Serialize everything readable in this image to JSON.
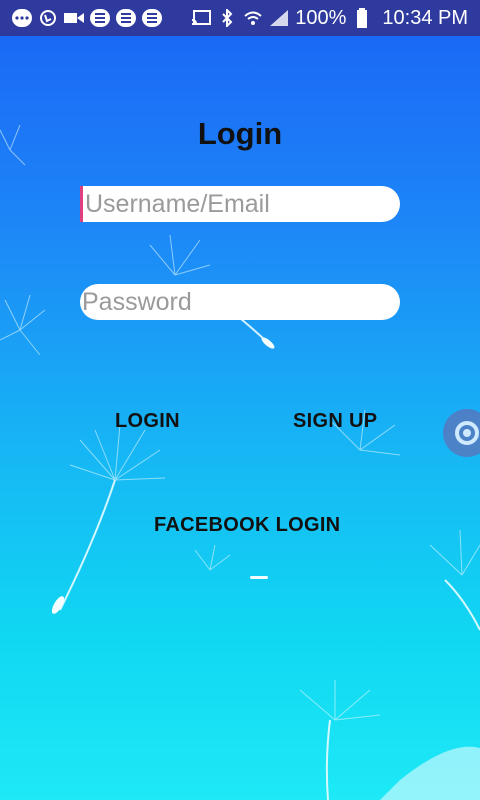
{
  "status_bar": {
    "battery": "100%",
    "time": "10:34 PM",
    "icons": [
      "dots-icon",
      "viber-icon",
      "video-icon",
      "message-icon",
      "message-icon",
      "message-icon",
      "cast-icon",
      "bluetooth-icon",
      "wifi-icon",
      "signal-icon",
      "battery-icon"
    ]
  },
  "login": {
    "title": "Login",
    "username_placeholder": "Username/Email",
    "password_placeholder": "Password",
    "login_label": "LOGIN",
    "signup_label": "SIGN UP",
    "facebook_label": "FACEBOOK LOGIN"
  },
  "colors": {
    "status_bar": "#2f3a9e",
    "bg_top": "#1a63f5",
    "bg_bottom": "#1ee9f6",
    "cursor": "#e0407f"
  }
}
